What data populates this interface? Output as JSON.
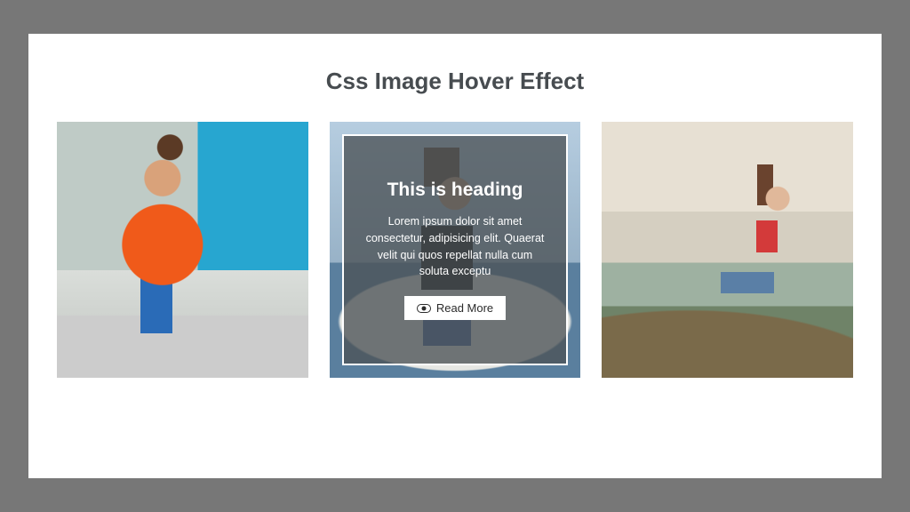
{
  "page": {
    "title": "Css Image Hover Effect"
  },
  "cards": [
    {
      "semantic": "image-card-1"
    },
    {
      "semantic": "image-card-2",
      "overlay": {
        "heading": "This is heading",
        "body": "Lorem ipsum dolor sit amet consectetur, adipisicing elit. Quaerat velit qui quos repellat nulla cum soluta exceptu",
        "button_label": "Read More"
      }
    },
    {
      "semantic": "image-card-3"
    }
  ]
}
